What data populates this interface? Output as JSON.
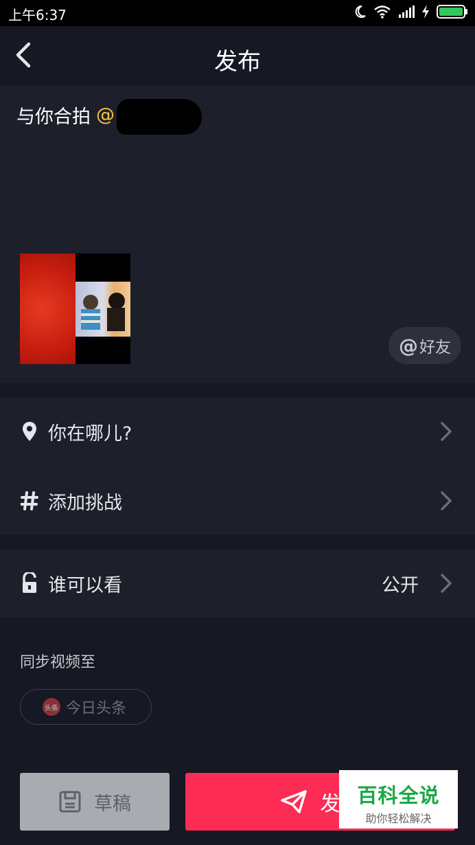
{
  "status_bar": {
    "time": "上午6:37"
  },
  "header": {
    "title": "发布"
  },
  "compose": {
    "caption_prefix": "与你合拍",
    "mention": "@",
    "at_friend_label": "好友"
  },
  "options": {
    "location_label": "你在哪儿?",
    "challenge_label": "添加挑战",
    "visibility_label": "谁可以看",
    "visibility_value": "公开"
  },
  "sync": {
    "title": "同步视频至",
    "toutiao_logo_text": "头条",
    "toutiao_label": "今日头条"
  },
  "actions": {
    "draft_label": "草稿",
    "publish_label": "发"
  },
  "watermark": {
    "title": "百科全说",
    "subtitle": "助你轻松解决"
  },
  "colors": {
    "background": "#161823",
    "panel": "#1d1f2b",
    "accent": "#fe2c55",
    "mention": "#f8c63c",
    "battery": "#34c759"
  }
}
